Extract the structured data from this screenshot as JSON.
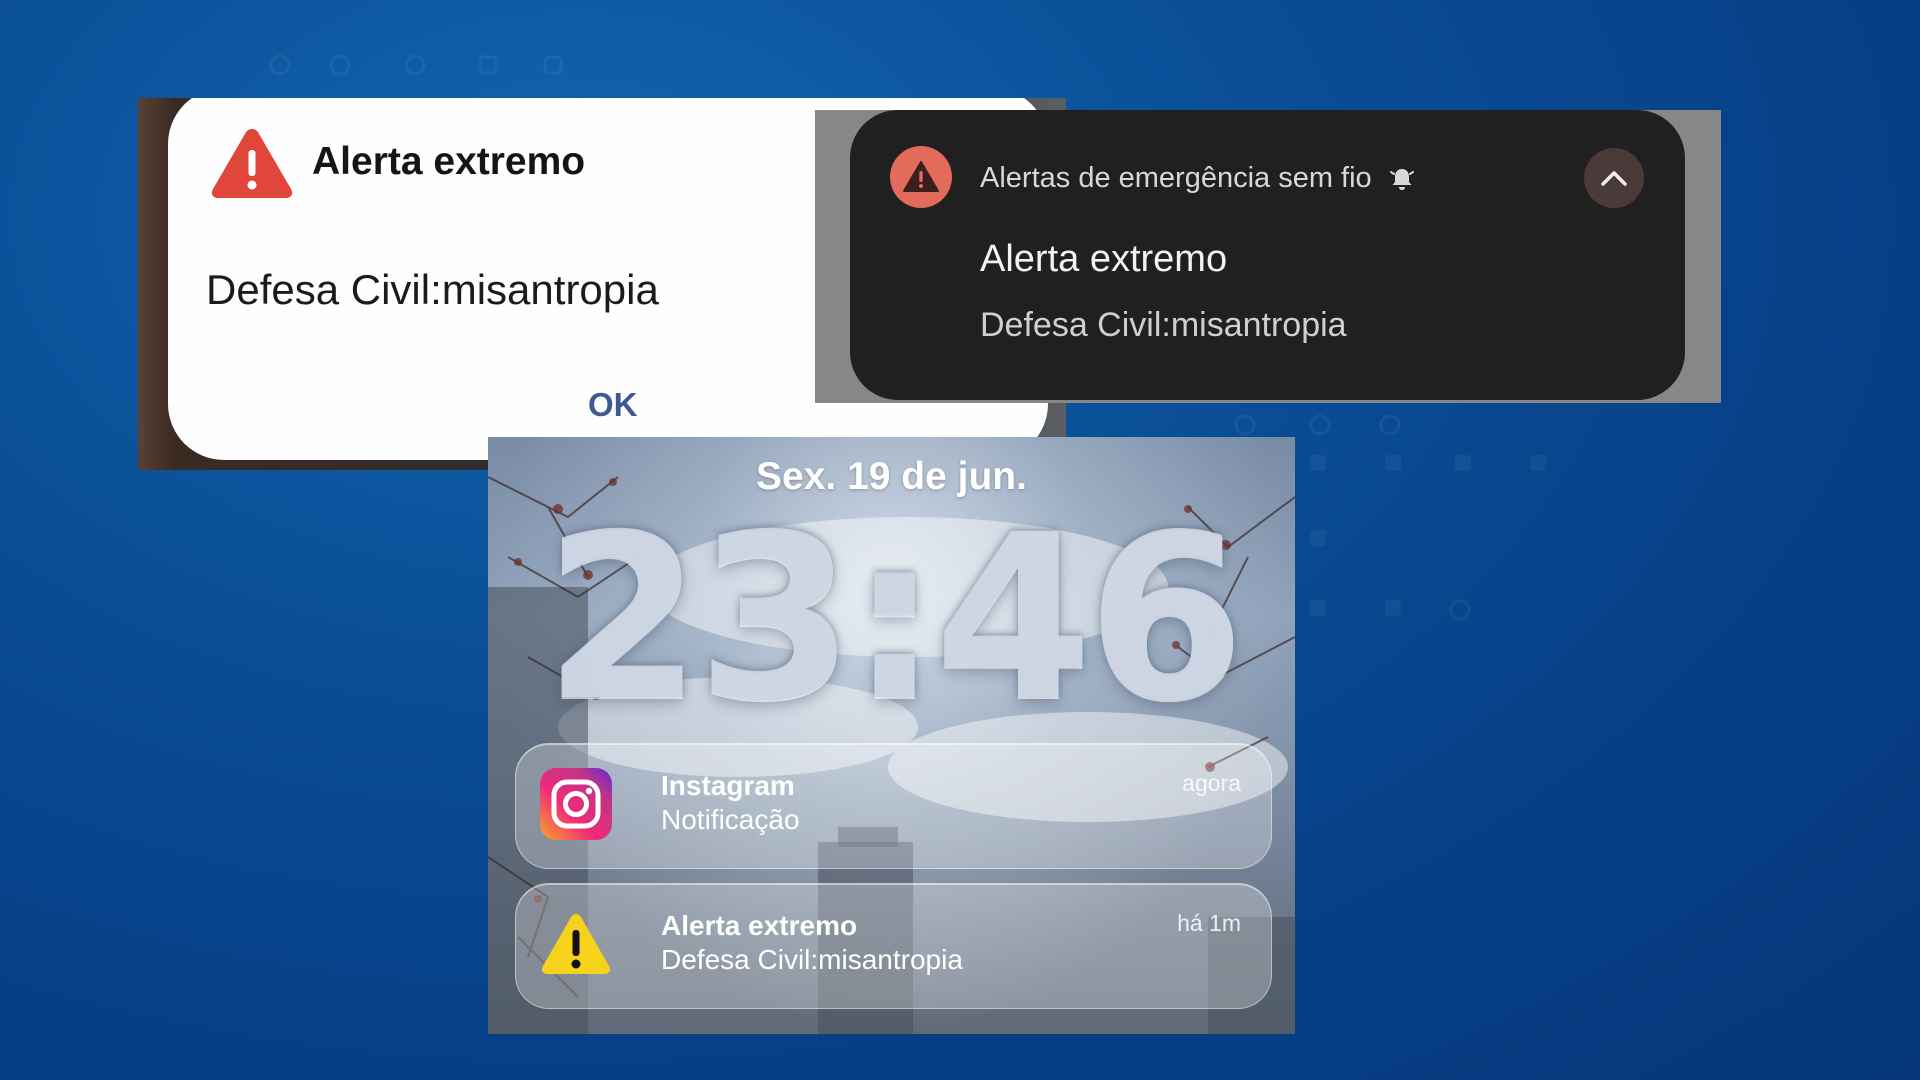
{
  "android_dialog": {
    "title": "Alerta extremo",
    "message": "Defesa Civil:misantropia",
    "ok_label": "OK",
    "icon": "warning-triangle-icon"
  },
  "android_notification": {
    "app_name": "Alertas de emergência sem fio",
    "title": "Alerta extremo",
    "message": "Defesa Civil:misantropia",
    "icons": [
      "warning-icon",
      "bell-icon",
      "chevron-up-icon"
    ]
  },
  "ios_lockscreen": {
    "date": "Sex. 19 de jun.",
    "time": "23:46",
    "notifications": [
      {
        "app": "Instagram",
        "body": "Notificação",
        "time": "agora",
        "icon": "instagram-icon"
      },
      {
        "app": "Alerta extremo",
        "body": "Defesa Civil:misantropia",
        "time": "há 1m",
        "icon": "warning-triangle-icon"
      }
    ]
  },
  "colors": {
    "background": "#0a4f98",
    "alert_red": "#e0463a",
    "ok_blue": "#3f5a90",
    "dark_card": "#202020",
    "ios_warning_yellow": "#f7d21a"
  }
}
